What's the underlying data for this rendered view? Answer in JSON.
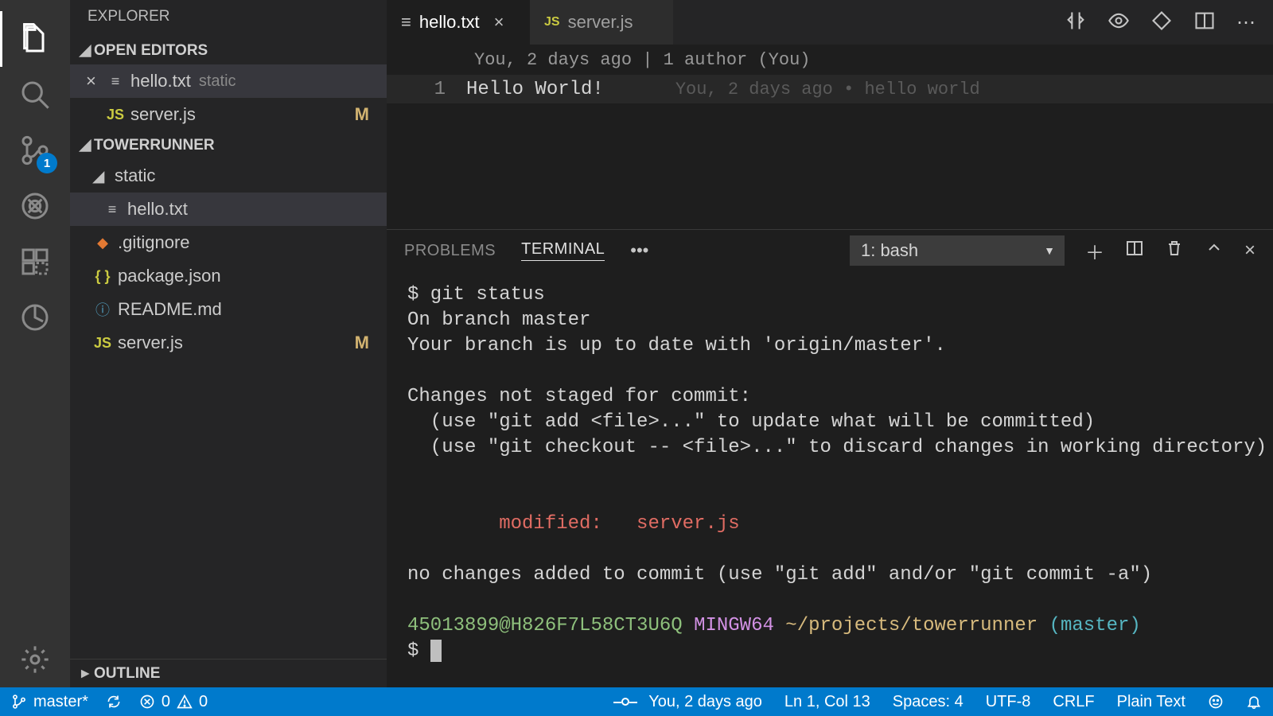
{
  "sidebar": {
    "title": "EXPLORER",
    "openEditors": {
      "header": "OPEN EDITORS",
      "items": [
        {
          "name": "hello.txt",
          "dir": "static",
          "icon": "txt",
          "active": true,
          "modified": ""
        },
        {
          "name": "server.js",
          "dir": "",
          "icon": "js",
          "active": false,
          "modified": "M"
        }
      ]
    },
    "workspace": {
      "header": "TOWERRUNNER",
      "folder": "static",
      "items": [
        {
          "name": "hello.txt",
          "icon": "txt",
          "modified": "",
          "indent": 2,
          "selected": true
        },
        {
          "name": ".gitignore",
          "icon": "git",
          "modified": "",
          "indent": 1
        },
        {
          "name": "package.json",
          "icon": "json",
          "modified": "",
          "indent": 1
        },
        {
          "name": "README.md",
          "icon": "info",
          "modified": "",
          "indent": 1
        },
        {
          "name": "server.js",
          "icon": "js",
          "modified": "M",
          "indent": 1
        }
      ]
    },
    "outline": "OUTLINE"
  },
  "activity": {
    "scmBadge": "1"
  },
  "tabs": [
    {
      "name": "hello.txt",
      "icon": "txt",
      "active": true,
      "dirty": false
    },
    {
      "name": "server.js",
      "icon": "js",
      "active": false,
      "dirty": false
    }
  ],
  "editor": {
    "codelens": "You, 2 days ago | 1 author (You)",
    "lineNumber": "1",
    "lineText": "Hello World!",
    "blame": "You, 2 days ago • hello world"
  },
  "panel": {
    "tabs": {
      "problems": "PROBLEMS",
      "terminal": "TERMINAL"
    },
    "terminalSelect": "1: bash",
    "terminal": {
      "l1": "$ git status",
      "l2": "On branch master",
      "l3": "Your branch is up to date with 'origin/master'.",
      "l4": "Changes not staged for commit:",
      "l5": "  (use \"git add <file>...\" to update what will be committed)",
      "l6": "  (use \"git checkout -- <file>...\" to discard changes in working directory)",
      "l7": "        modified:   server.js",
      "l8": "no changes added to commit (use \"git add\" and/or \"git commit -a\")",
      "promptUser": "45013899@H826F7L58CT3U6Q",
      "promptSys": "MINGW64",
      "promptPath": "~/projects/towerrunner",
      "promptBranch": "(master)",
      "promptChar": "$"
    }
  },
  "status": {
    "branch": "master*",
    "errors": "0",
    "warnings": "0",
    "blame": "You, 2 days ago",
    "cursor": "Ln 1, Col 13",
    "spaces": "Spaces: 4",
    "encoding": "UTF-8",
    "eol": "CRLF",
    "lang": "Plain Text"
  }
}
